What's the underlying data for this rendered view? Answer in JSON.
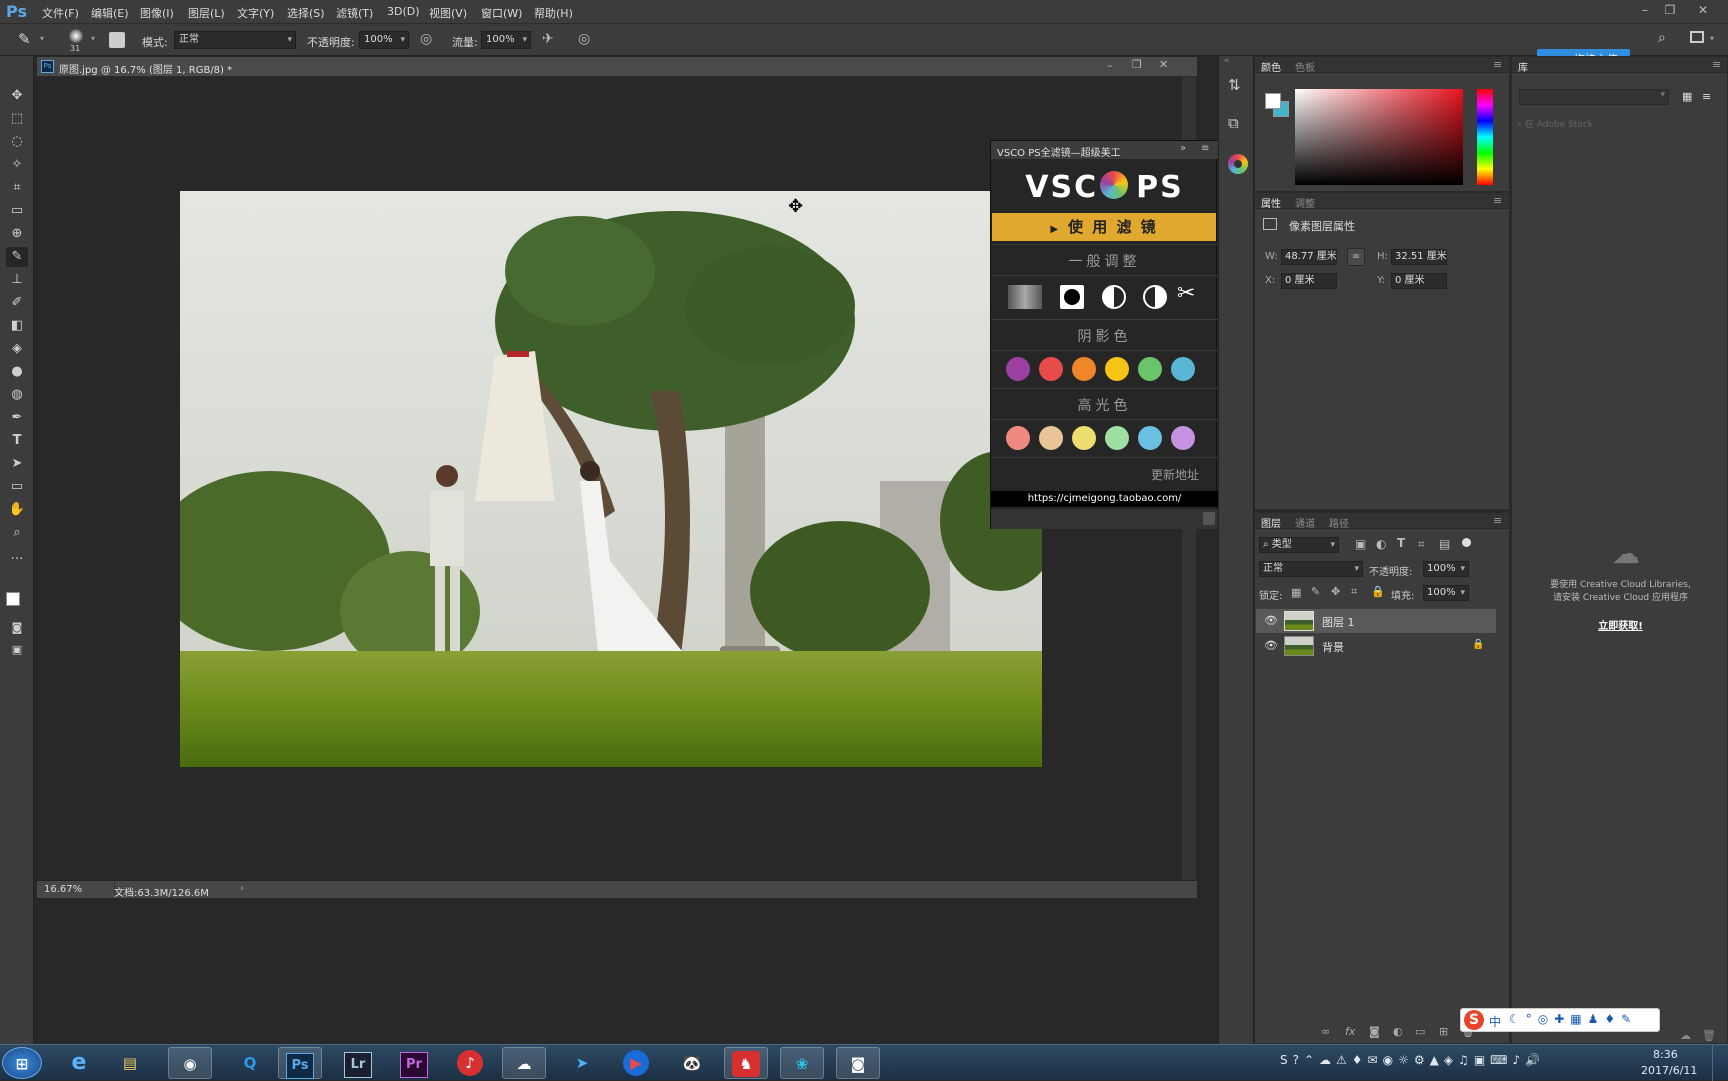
{
  "app": {
    "logo": "Ps"
  },
  "menu": [
    "文件(F)",
    "编辑(E)",
    "图像(I)",
    "图层(L)",
    "文字(Y)",
    "选择(S)",
    "滤镜(T)",
    "3D(D)",
    "视图(V)",
    "窗口(W)",
    "帮助(H)"
  ],
  "options": {
    "brush_size": "31",
    "mode_label": "模式:",
    "mode_value": "正常",
    "opacity_label": "不透明度:",
    "opacity_value": "100%",
    "flow_label": "流量:",
    "flow_value": "100%",
    "upload_label": "拖拽上传"
  },
  "tools": [
    "move-tool",
    "marquee-tool",
    "lasso-tool",
    "magic-wand-tool",
    "crop-tool",
    "eyedropper-tool",
    "healing-tool",
    "brush-tool",
    "stamp-tool",
    "history-brush-tool",
    "eraser-tool",
    "bucket-tool",
    "blur-tool",
    "dodge-tool",
    "pen-tool",
    "type-tool",
    "path-select-tool",
    "rectangle-tool",
    "hand-tool",
    "zoom-tool",
    "more-tools"
  ],
  "document": {
    "tab_title": "原图.jpg @ 16.7% (图层 1, RGB/8) *",
    "zoom": "16.67%",
    "doc_size": "文档:63.3M/126.6M"
  },
  "vsco": {
    "title": "VSCO PS全滤镜—超级美工",
    "logo_left": "VSC",
    "logo_right": "PS",
    "apply_label": "使 用 滤 镜",
    "general_label": "一般调整",
    "shadow_label": "阴影色",
    "highlight_label": "高光色",
    "update_label": "更新地址",
    "url": "https://cjmeigong.taobao.com/",
    "shadow_colors": [
      "#9b3fa0",
      "#e94b4b",
      "#f0862a",
      "#f5c414",
      "#6ac46a",
      "#5ab4d4"
    ],
    "highlight_colors": [
      "#f08a80",
      "#e8c498",
      "#eede70",
      "#9ee0a4",
      "#6ac0e0",
      "#c492e0"
    ]
  },
  "color_panel": {
    "tab1": "颜色",
    "tab2": "色板"
  },
  "properties": {
    "tab1": "属性",
    "tab2": "调整",
    "title": "像素图层属性",
    "w_label": "W:",
    "w_value": "48.77 厘米",
    "h_label": "H:",
    "h_value": "32.51 厘米",
    "x_label": "X:",
    "x_value": "0 厘米",
    "y_label": "Y:",
    "y_value": "0 厘米"
  },
  "layers": {
    "tab1": "图层",
    "tab2": "通道",
    "tab3": "路径",
    "kind": "类型",
    "blend": "正常",
    "opacity_label": "不透明度:",
    "opacity_value": "100%",
    "lock_label": "锁定:",
    "fill_label": "填充:",
    "fill_value": "100%",
    "items": [
      {
        "name": "图层 1"
      },
      {
        "name": "背景"
      }
    ]
  },
  "library": {
    "tab": "库",
    "search_placeholder": "在 Adobe Stock",
    "msg1": "要使用 Creative Cloud Libraries,",
    "msg2": "请安装 Creative Cloud 应用程序",
    "link": "立即获取!"
  },
  "ime": {
    "label": "中"
  },
  "taskbar": {
    "apps": [
      "start-button",
      "ie-browser",
      "file-explorer",
      "camera-app",
      "qq-browser",
      "photoshop",
      "lightroom",
      "premiere",
      "netease-music",
      "baidu-netdisk",
      "feishu",
      "player-app",
      "panda-app",
      "red-app",
      "film-app",
      "record-app"
    ],
    "time": "8:36",
    "date": "2017/6/11"
  },
  "colors": {
    "accent": "#2f8ee0",
    "vsco_apply": "#e0a82e",
    "ps_blue": "#5aa8e8"
  }
}
